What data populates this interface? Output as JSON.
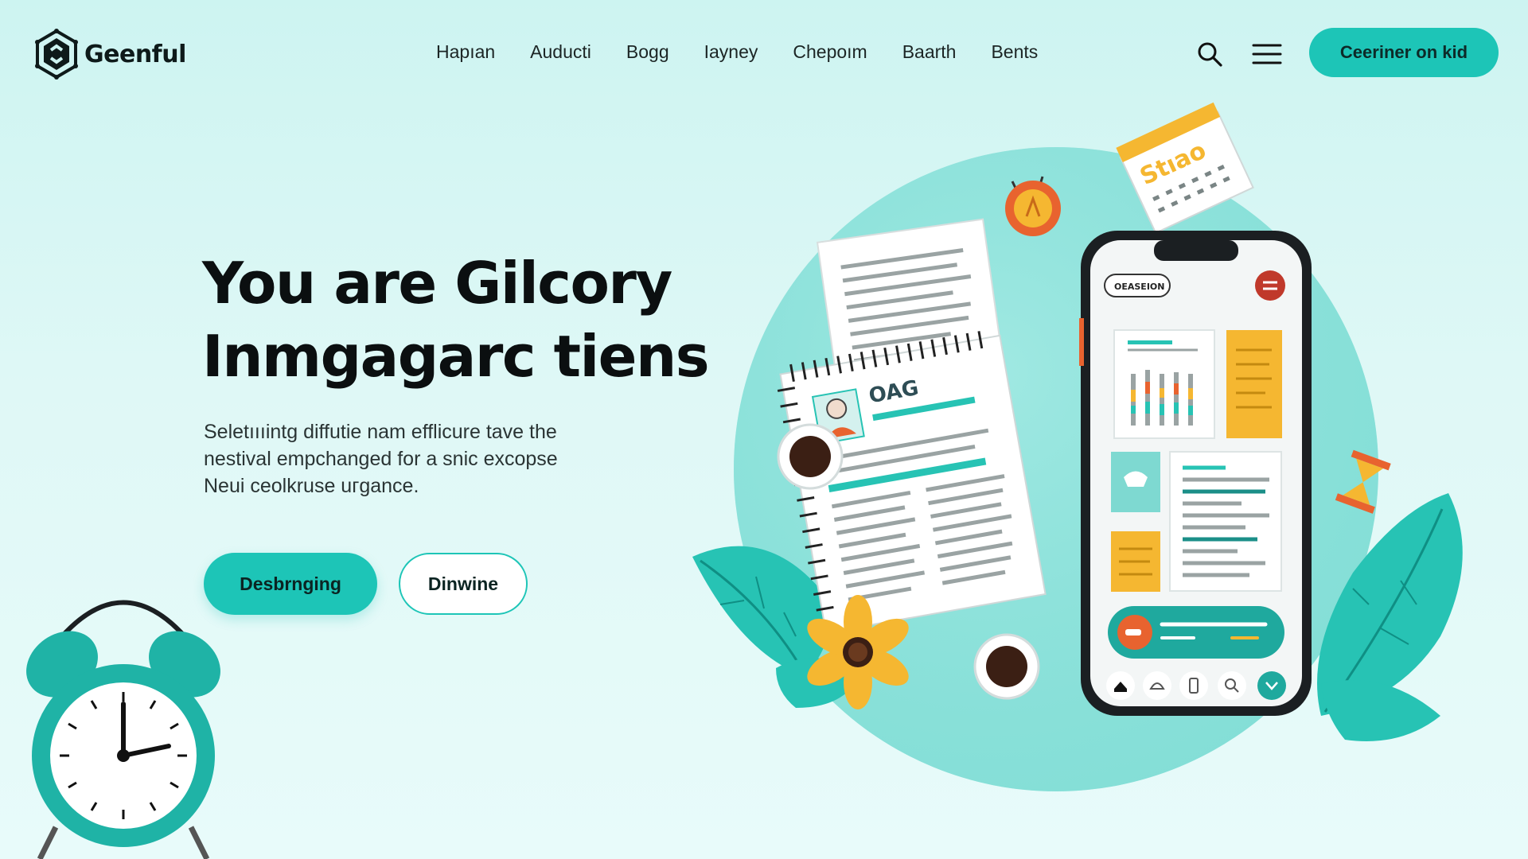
{
  "brand": {
    "name": "Geenful"
  },
  "nav": {
    "items": [
      {
        "label": "Hapıan"
      },
      {
        "label": "Auducti"
      },
      {
        "label": "Bogg"
      },
      {
        "label": "Iayney"
      },
      {
        "label": "Chepoım"
      },
      {
        "label": "Baarth"
      },
      {
        "label": "Bents"
      }
    ]
  },
  "header": {
    "search_icon": "search-icon",
    "menu_icon": "hamburger-menu-icon",
    "cta_label": "Ceeriner on kid"
  },
  "hero": {
    "title_line1": "You are Gilcory",
    "title_line2": "Inmgagarc tiens",
    "desc_line1": "Seletıııintg diffutie nam efflicure tave the",
    "desc_line2": "nestival empchanged for a snic excopse",
    "desc_line3": "Neui ceolkruse uгgance.",
    "primary_label": "Desbrnging",
    "secondary_label": "Dinwine"
  },
  "illustration": {
    "calendar_text": "Stıao",
    "notebook_text": "OAG",
    "phone_search_chip": "OEASEION"
  },
  "colors": {
    "accent": "#1dc5b7",
    "background": "#d6f6f3",
    "circle": "#8fe3dc",
    "yellow": "#f5b731",
    "orange": "#e8632f",
    "dark": "#0b0f10"
  }
}
